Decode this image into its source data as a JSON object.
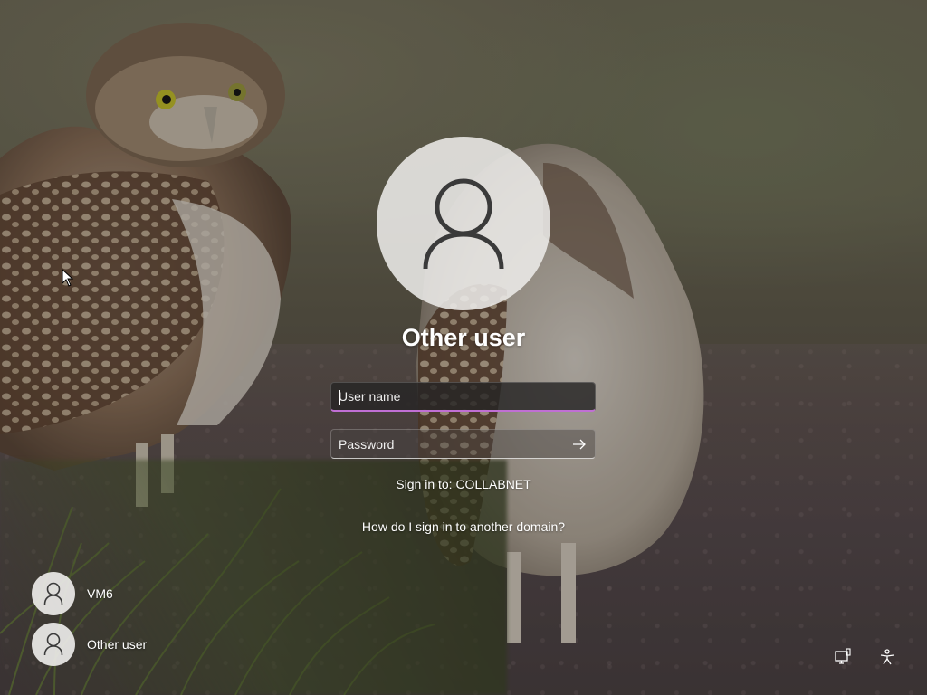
{
  "login": {
    "title": "Other user",
    "username_placeholder": "User name",
    "password_placeholder": "Password",
    "signin_domain": "Sign in to: COLLABNET",
    "domain_help_link": "How do I sign in to another domain?"
  },
  "users": [
    {
      "name": "VM6",
      "icon": "user-avatar-icon"
    },
    {
      "name": "Other user",
      "icon": "user-avatar-icon"
    }
  ],
  "corner_icons": [
    "network-icon",
    "accessibility-icon"
  ],
  "colors": {
    "accent_underline": "#c06fd4",
    "text": "#ffffff",
    "avatar_bg": "#eceae8"
  }
}
